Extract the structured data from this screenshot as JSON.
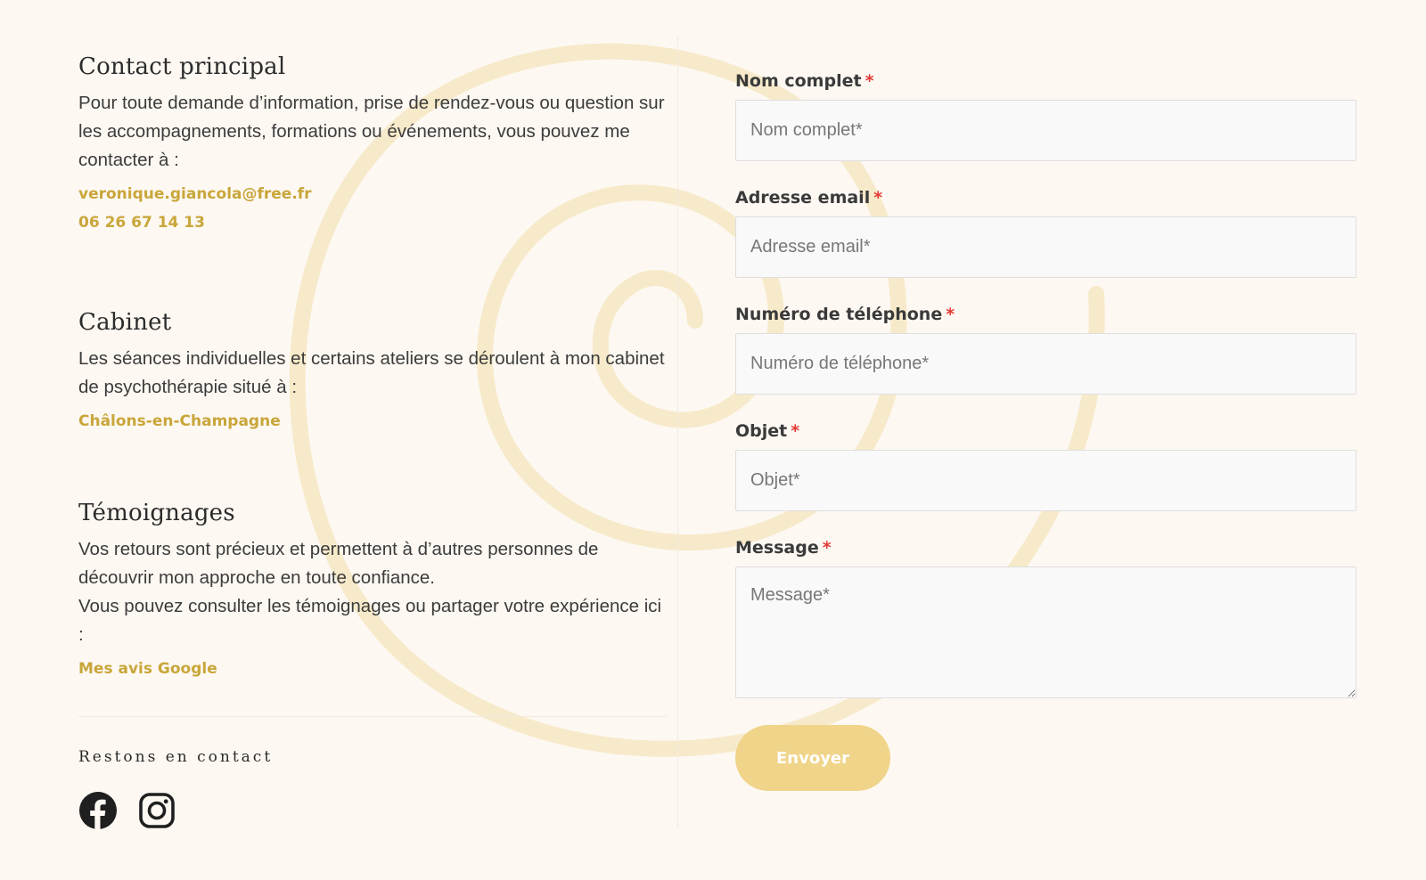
{
  "contact": {
    "title": "Contact principal",
    "text": "Pour toute demande d’information, prise de rendez-vous ou question sur les accompagnements, formations ou événements, vous pouvez me contacter à :",
    "email": "veronique.giancola@free.fr",
    "phone": "06 26 67 14 13"
  },
  "cabinet": {
    "title": "Cabinet",
    "text": "Les séances individuelles et certains ateliers se déroulent à mon cabinet de psychothérapie situé à :",
    "location": "Châlons-en-Champagne"
  },
  "temoignages": {
    "title": "Témoignages",
    "text1": "Vos retours sont précieux et permettent à d’autres personnes de découvrir mon approche en toute confiance.",
    "text2": "Vous pouvez consulter les témoignages ou partager votre expérience ici :",
    "link": "Mes avis Google"
  },
  "social": {
    "title": "Restons en contact",
    "icons": [
      "facebook-icon",
      "instagram-icon"
    ]
  },
  "form": {
    "required_mark": "*",
    "name": {
      "label": "Nom complet",
      "placeholder": "Nom complet*"
    },
    "email": {
      "label": "Adresse email",
      "placeholder": "Adresse email*"
    },
    "phone": {
      "label": "Numéro de téléphone",
      "placeholder": "Numéro de téléphone*"
    },
    "subject": {
      "label": "Objet",
      "placeholder": "Objet*"
    },
    "message": {
      "label": "Message",
      "placeholder": "Message*"
    },
    "submit": "Envoyer"
  },
  "colors": {
    "background": "#fdf8f2",
    "accent_gold": "#c9a63a",
    "button": "#f0d489",
    "required": "#e53935",
    "spiral": "#f3dfa9"
  }
}
